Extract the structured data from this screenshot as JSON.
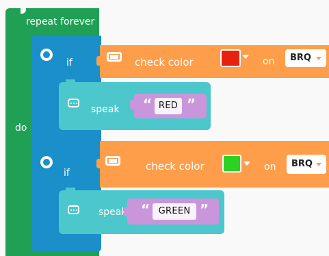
{
  "repeat_block": {
    "label": "repeat forever",
    "do_label": "do"
  },
  "if_blocks": [
    {
      "label": "if",
      "condition": {
        "label": "check color",
        "on_label": "on",
        "port": "BRQ",
        "color_name": "red",
        "swatch": "#e6220f"
      },
      "speak": {
        "label": "speak",
        "text": "RED"
      }
    },
    {
      "label": "if",
      "condition": {
        "label": "check color",
        "on_label": "on",
        "port": "BRQ",
        "color_name": "green",
        "swatch": "#2bd224"
      },
      "speak": {
        "label": "speak",
        "text": "GREEN"
      }
    }
  ],
  "colors": {
    "repeat": "#1fa055",
    "if": "#1a8fc9",
    "sensor": "#ff9e4a",
    "speak": "#4cc7cc",
    "string": "#c996dc"
  }
}
